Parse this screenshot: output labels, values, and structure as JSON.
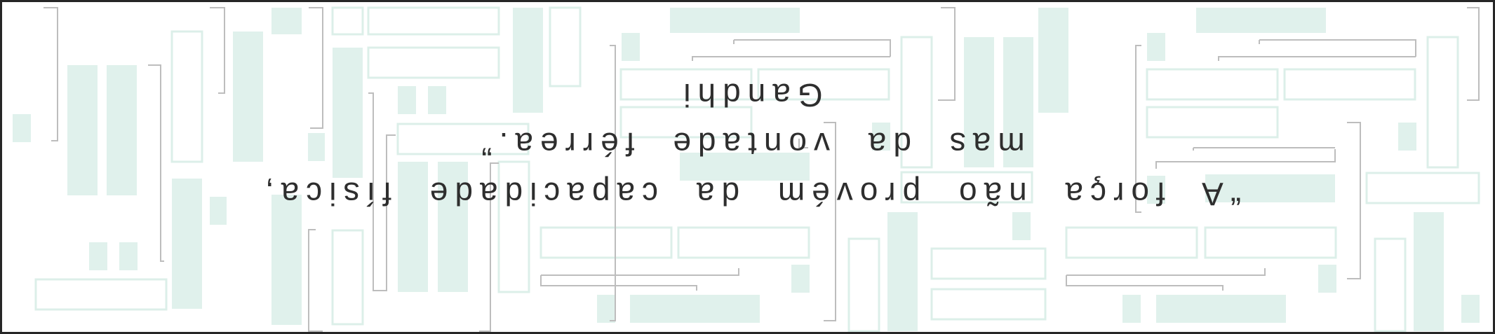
{
  "quote": {
    "line1": "“A força não provém da capacidade física,",
    "line2": "mas da vontade férrea.”",
    "author": "Gandhi"
  },
  "colors": {
    "accent_fill": "#e0f1ec",
    "accent_stroke": "#dcefe9",
    "line_gray": "#bdbdbd",
    "border": "#262626",
    "text": "#2e2e2e"
  }
}
